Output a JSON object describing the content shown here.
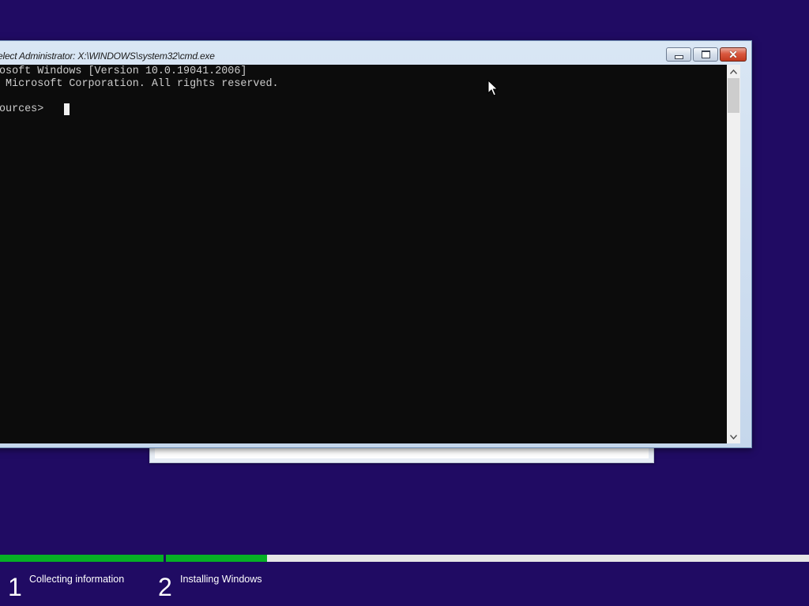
{
  "console": {
    "title": "elect Administrator: X:\\WINDOWS\\system32\\cmd.exe",
    "lines": [
      "osoft Windows [Version 10.0.19041.2006]",
      " Microsoft Corporation. All rights reserved.",
      "",
      "ources>"
    ],
    "buttons": {
      "minimize": "minimize-icon",
      "maximize": "maximize-icon",
      "close": "close-icon"
    }
  },
  "setup": {
    "steps": [
      {
        "number": "1",
        "label": "Collecting information",
        "progress": 1.0
      },
      {
        "number": "2",
        "label": "Installing Windows",
        "progress": 0.157
      }
    ]
  },
  "colors": {
    "desktop": "#200b63",
    "console_bg": "#0c0c0c",
    "console_fg": "#cccccc",
    "progress_fill": "#06b025",
    "progress_track": "#e6e6e6"
  }
}
